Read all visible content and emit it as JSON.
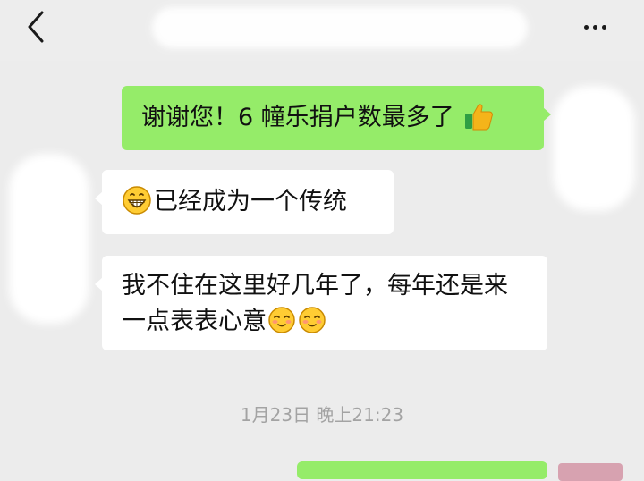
{
  "chat": {
    "back_icon": "chevron-left-icon",
    "more_icon": "more-dots-icon",
    "messages": [
      {
        "direction": "sent",
        "text": "谢谢您！6 幢乐捐户数最多了",
        "trailing_emoji": "thumbs-up-emoji"
      },
      {
        "direction": "received",
        "leading_emoji": "grin-emoji",
        "text": "已经成为一个传统"
      },
      {
        "direction": "received",
        "text": "我不住在这里好几年了，每年还是来一点表表心意",
        "trailing_emojis": [
          "shy-smile-emoji",
          "shy-smile-emoji"
        ]
      }
    ],
    "timestamp": "1月23日 晚上21:23"
  },
  "colors": {
    "sent_bubble": "#95ec69",
    "received_bubble": "#ffffff",
    "background": "#ececec",
    "timestamp_text": "#a3a3a3"
  }
}
